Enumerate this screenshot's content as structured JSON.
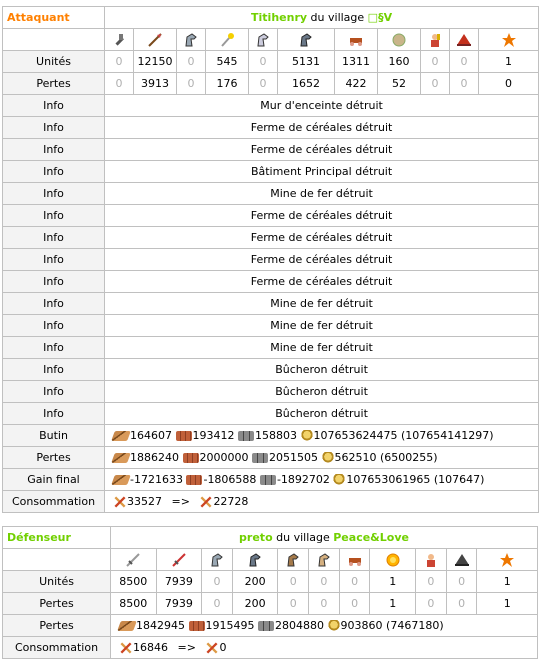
{
  "attacker": {
    "role": "Attaquant",
    "player": "Titihenry",
    "village_text": "du village",
    "village": "□§V",
    "troop_icons": [
      "clubswinger-icon",
      "spearman-icon",
      "horse-icon",
      "wand-icon",
      "horse-icon",
      "knight-icon",
      "ram-icon",
      "catapult-icon",
      "chief-icon",
      "settler-hat-icon",
      "hero-star-icon"
    ],
    "units_label": "Unités",
    "units": [
      "0",
      "12150",
      "0",
      "545",
      "0",
      "5131",
      "1311",
      "160",
      "0",
      "0",
      "1"
    ],
    "losses_label": "Pertes",
    "losses": [
      "0",
      "3913",
      "0",
      "176",
      "0",
      "1652",
      "422",
      "52",
      "0",
      "0",
      "0"
    ],
    "info_label": "Info",
    "infos": [
      "Mur d'enceinte détruit",
      "Ferme de céréales détruit",
      "Ferme de céréales détruit",
      "Bâtiment Principal détruit",
      "Mine de fer détruit",
      "Ferme de céréales détruit",
      "Ferme de céréales détruit",
      "Ferme de céréales détruit",
      "Ferme de céréales détruit",
      "Mine de fer détruit",
      "Mine de fer détruit",
      "Mine de fer détruit",
      "Bûcheron détruit",
      "Bûcheron détruit",
      "Bûcheron détruit"
    ],
    "bounty_label": "Butin",
    "bounty": {
      "wood": "164607",
      "clay": "193412",
      "iron": "158803",
      "crop": "107653624475",
      "total": "(107654141297)"
    },
    "loss_res_label": "Pertes",
    "loss_res": {
      "wood": "1886240",
      "clay": "2000000",
      "iron": "2051505",
      "crop": "562510",
      "total": "(6500255)"
    },
    "final_label": "Gain final",
    "final": {
      "wood": "-1721633",
      "clay": "-1806588",
      "iron": "-1892702",
      "crop": "107653061965",
      "total": "(107647)"
    },
    "consumption_label": "Consommation",
    "consumption": {
      "before": "33527",
      "arrow": "=>",
      "after": "22728"
    }
  },
  "defender": {
    "role": "Défenseur",
    "player": "preto",
    "village_text": "du village",
    "village": "Peace&Love",
    "troop_icons": [
      "sword-icon",
      "red-sword-icon",
      "horse-icon",
      "horse-icon",
      "horse-icon",
      "horse-icon",
      "ram-icon",
      "sun-icon",
      "chief-icon",
      "settler-hat-icon",
      "hero-star-icon"
    ],
    "units_label": "Unités",
    "units": [
      "8500",
      "7939",
      "0",
      "200",
      "0",
      "0",
      "0",
      "1",
      "0",
      "0",
      "1"
    ],
    "losses_label": "Pertes",
    "losses": [
      "8500",
      "7939",
      "0",
      "200",
      "0",
      "0",
      "0",
      "1",
      "0",
      "0",
      "1"
    ],
    "loss_res_label": "Pertes",
    "loss_res": {
      "wood": "1842945",
      "clay": "1915495",
      "iron": "2804880",
      "crop": "903860",
      "total": "(7467180)"
    },
    "consumption_label": "Consommation",
    "consumption": {
      "before": "16846",
      "arrow": "=>",
      "after": "0"
    }
  },
  "colors": {
    "attacker": "#ff8000",
    "player": "#71d000",
    "zero": "#b0b0b0",
    "label_bg": "#f3f3f3",
    "border": "#c0c0c0"
  }
}
